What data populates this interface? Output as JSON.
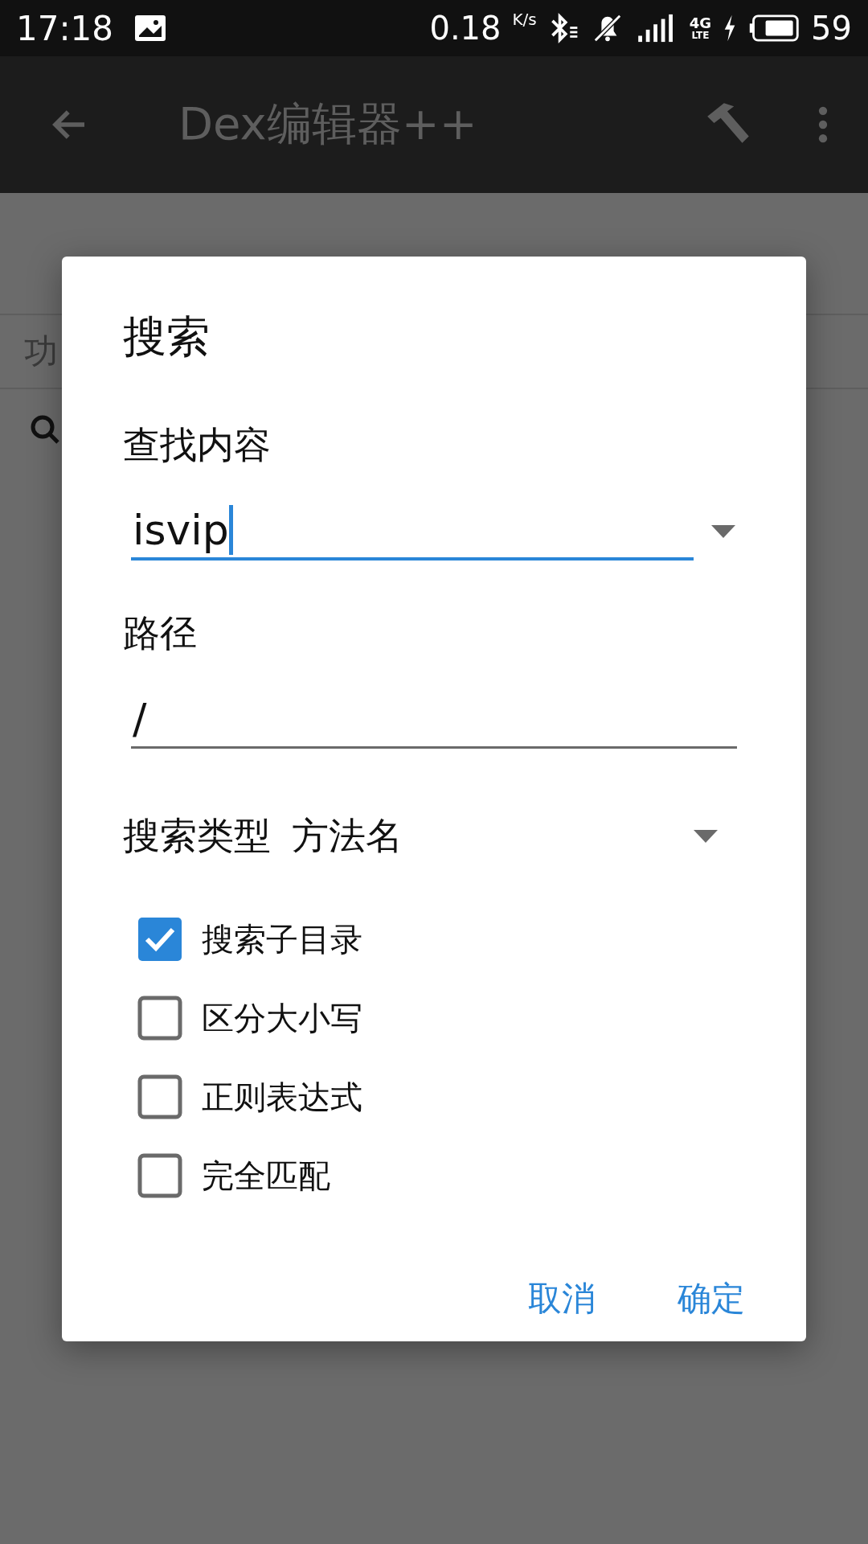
{
  "status_bar": {
    "time": "17:18",
    "speed": "0.18",
    "speed_unit": "K/s",
    "network": "4G",
    "network_sub": "LTE",
    "battery": "59"
  },
  "app_bar": {
    "title": "Dex编辑器++"
  },
  "section_label": "功",
  "dialog": {
    "title": "搜索",
    "find_label": "查找内容",
    "find_value": "isvip",
    "find_focused": true,
    "path_label": "路径",
    "path_value": "/",
    "path_focused": false,
    "type_label": "搜索类型",
    "type_value": "方法名",
    "options": [
      {
        "label": "搜索子目录",
        "checked": true
      },
      {
        "label": "区分大小写",
        "checked": false
      },
      {
        "label": "正则表达式",
        "checked": false
      },
      {
        "label": "完全匹配",
        "checked": false
      }
    ],
    "buttons": [
      "取消",
      "确定"
    ]
  }
}
